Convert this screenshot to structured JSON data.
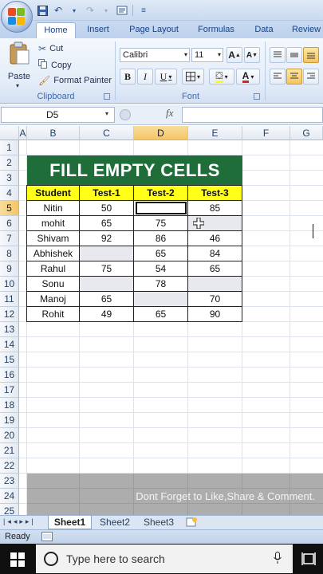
{
  "ribbon": {
    "tabs": [
      "Home",
      "Insert",
      "Page Layout",
      "Formulas",
      "Data",
      "Review"
    ],
    "clipboard": {
      "paste_label": "Paste",
      "cut_label": "Cut",
      "copy_label": "Copy",
      "format_painter_label": "Format Painter",
      "group_label": "Clipboard"
    },
    "font": {
      "font_name": "Calibri",
      "font_size": "11",
      "group_label": "Font",
      "bold_label": "B",
      "italic_label": "I",
      "underline_label": "U",
      "grow_label": "A",
      "shrink_label": "A",
      "color_label": "A"
    }
  },
  "formula_bar": {
    "name_box": "D5",
    "fx_label": "fx",
    "content": ""
  },
  "grid": {
    "columns": [
      "A",
      "B",
      "C",
      "D",
      "E",
      "F",
      "G"
    ],
    "rows": [
      "1",
      "2",
      "3",
      "4",
      "5",
      "6",
      "7",
      "8",
      "9",
      "10",
      "11",
      "12",
      "13",
      "14",
      "15",
      "16",
      "17",
      "18",
      "19",
      "20",
      "21",
      "22",
      "23",
      "24",
      "25"
    ],
    "selected_column": "D",
    "selected_row": "5"
  },
  "table": {
    "title": "FILL EMPTY CELLS",
    "headers": [
      "Student",
      "Test-1",
      "Test-2",
      "Test-3"
    ],
    "rows": [
      [
        "Nitin",
        "50",
        "",
        "85"
      ],
      [
        "mohit",
        "65",
        "75",
        ""
      ],
      [
        "Shivam",
        "92",
        "86",
        "46"
      ],
      [
        "Abhishek",
        "",
        "65",
        "84"
      ],
      [
        "Rahul",
        "75",
        "54",
        "65"
      ],
      [
        "Sonu",
        "",
        "78",
        ""
      ],
      [
        "Manoj",
        "65",
        "",
        "70"
      ],
      [
        "Rohit",
        "49",
        "65",
        "90"
      ]
    ],
    "colors": {
      "banner_bg": "#1f6e3a",
      "header_bg": "#ffff1a"
    }
  },
  "overlay_text": "Dont Forget to Like,Share & Comment.",
  "sheets": [
    "Sheet1",
    "Sheet2",
    "Sheet3"
  ],
  "status": {
    "mode": "Ready"
  },
  "taskbar": {
    "search_placeholder": "Type here to search"
  }
}
